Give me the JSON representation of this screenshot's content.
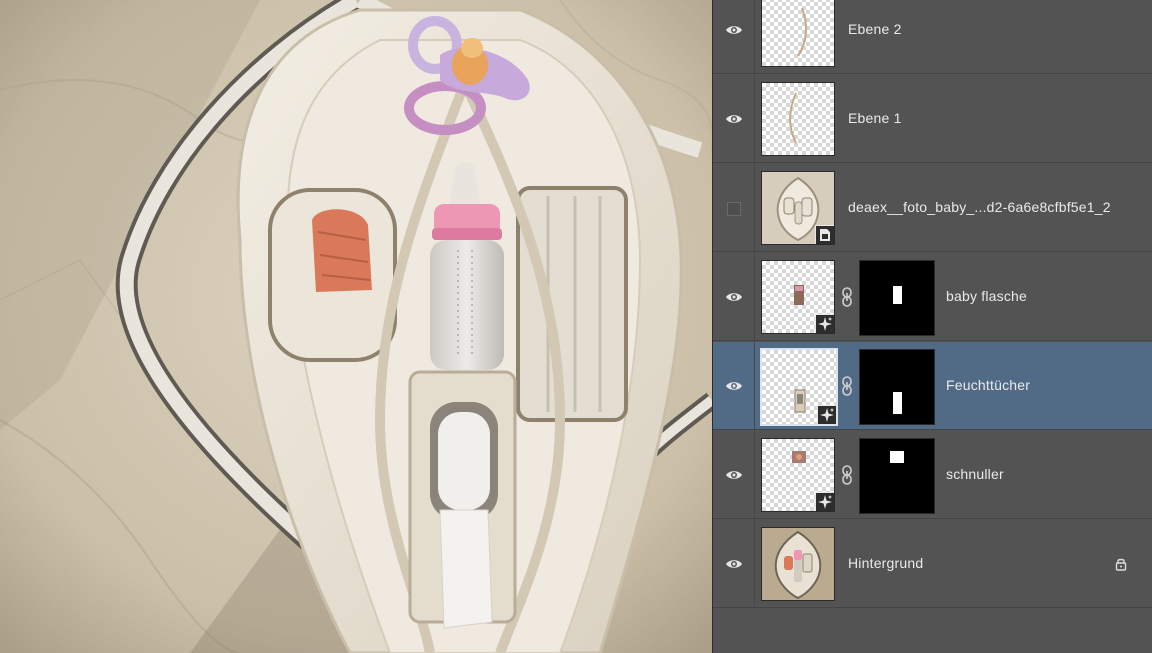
{
  "layers": [
    {
      "name": "Ebene 2",
      "visible": true,
      "selected": false,
      "type": "pixel",
      "thumb_icon": "stroke-curve-icon"
    },
    {
      "name": "Ebene 1",
      "visible": true,
      "selected": false,
      "type": "pixel",
      "thumb_icon": "stroke-curve-icon"
    },
    {
      "name": "deaex__foto_baby_...d2-6a6e8cfbf5e1_2",
      "visible": false,
      "selected": false,
      "type": "smart-object-linked",
      "thumb_icon": "bag-photo-icon"
    },
    {
      "name": "baby flasche",
      "visible": true,
      "selected": false,
      "type": "smart-object-generative",
      "has_mask": true
    },
    {
      "name": "Feuchttücher",
      "visible": true,
      "selected": true,
      "type": "smart-object-generative",
      "has_mask": true
    },
    {
      "name": "schnuller",
      "visible": true,
      "selected": false,
      "type": "smart-object-generative",
      "has_mask": true
    },
    {
      "name": "Hintergrund",
      "visible": true,
      "selected": false,
      "type": "background",
      "locked": true
    }
  ],
  "colors": {
    "panel_bg": "#535353",
    "selected_row": "#516b86",
    "text": "#eaeaea"
  },
  "icons": [
    "eye-icon",
    "link-chain-icon",
    "smart-object-badge-icon",
    "lock-icon"
  ]
}
